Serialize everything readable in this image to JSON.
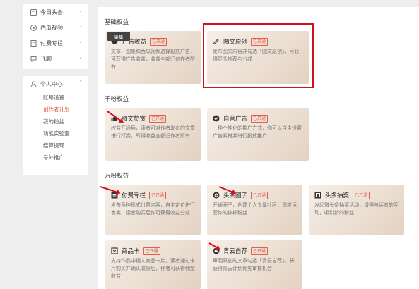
{
  "sidebar": {
    "groups": [
      {
        "label": "今日头条"
      },
      {
        "label": "西瓜视频"
      },
      {
        "label": "付费专栏"
      },
      {
        "label": "飞聊"
      }
    ],
    "personal": {
      "label": "个人中心",
      "items": [
        {
          "label": "账号设置"
        },
        {
          "label": "创作者计划"
        },
        {
          "label": "我的粉丝"
        },
        {
          "label": "功能实验室"
        },
        {
          "label": "结算提现"
        },
        {
          "label": "号外推广"
        }
      ]
    }
  },
  "main": {
    "sections": [
      {
        "title": "基础权益"
      },
      {
        "title": "千粉权益"
      },
      {
        "title": "万粉权益"
      }
    ],
    "badge_label": "已开通",
    "tooltip": "采集",
    "cards": [
      {
        "title": "广告收益",
        "desc": "文章、图集和西瓜视频选择投放广告，可获得广告收益，收益全部归创作者所有"
      },
      {
        "title": "图文原创",
        "desc": "发布图文内容并勾选「图文原创」，可获得更多推荐与分成"
      },
      {
        "title": "图文赞赏",
        "desc": "权益开通后，读者可对作者发布的文章进行打赏，所得收益全部归作者所有"
      },
      {
        "title": "自营广告",
        "desc": "一种个性化的推广方式，你可以自主设置广告素材并进行投放推广"
      },
      {
        "title": "付费专栏",
        "desc": "发布多种形式付费内容，自主定价进行售卖，读者购买后你可获得收益分成"
      },
      {
        "title": "头条圈子",
        "desc": "开通圈子，创建个人专属社区，深度运营你的铁杆粉丝"
      },
      {
        "title": "头条抽奖",
        "desc": "发起微头条抽奖活动，增强与读者的互动，吸引新的粉丝"
      },
      {
        "title": "商品卡",
        "desc": "支持作品中插入商品卡片，读者通过卡片购买并确认收货后，作者可获得佣金收益"
      },
      {
        "title": "青云自荐",
        "desc": "声明原创的文章勾选「青云自荐」，将获得青云计划优先审核机会"
      }
    ]
  },
  "colors": {
    "accent": "#e04a3a",
    "highlight": "#c8141e"
  }
}
